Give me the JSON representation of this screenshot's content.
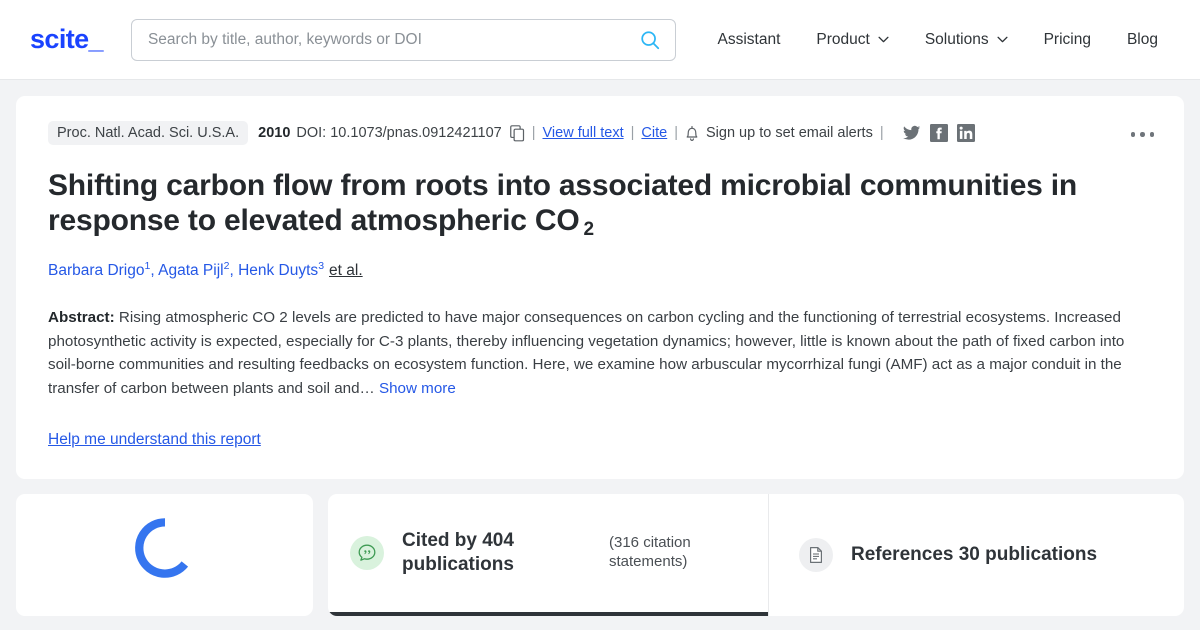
{
  "header": {
    "logo": "scite_",
    "search": {
      "placeholder": "Search by title, author, keywords or DOI",
      "value": "",
      "icon": "search-icon"
    },
    "nav": [
      {
        "label": "Assistant",
        "has_caret": false
      },
      {
        "label": "Product",
        "has_caret": true
      },
      {
        "label": "Solutions",
        "has_caret": true
      },
      {
        "label": "Pricing",
        "has_caret": false
      },
      {
        "label": "Blog",
        "has_caret": false
      }
    ]
  },
  "paper": {
    "journal": "Proc. Natl. Acad. Sci. U.S.A.",
    "year": "2010",
    "doi": "DOI: 10.1073/pnas.0912421107",
    "copy_icon": "copy-icon",
    "view_full_text": "View full text",
    "cite": "Cite",
    "alerts_icon": "bell-icon",
    "alerts": "Sign up to set email alerts",
    "separator": "|",
    "socials": [
      {
        "name": "twitter-icon"
      },
      {
        "name": "facebook-icon"
      },
      {
        "name": "linkedin-icon"
      }
    ],
    "more_menu_icon": "kebab-menu-icon",
    "title_main": "Shifting carbon flow from roots into associated microbial communities in response to elevated atmospheric CO",
    "title_sub": "2",
    "authors": [
      {
        "name": "Barbara Drigo",
        "affiliation": "1"
      },
      {
        "name": "Agata Pijl",
        "affiliation": "2"
      },
      {
        "name": "Henk Duyts",
        "affiliation": "3"
      }
    ],
    "et_al": "et al.",
    "abstract_label": "Abstract:",
    "abstract_text": "Rising atmospheric CO 2 levels are predicted to have major consequences on carbon cycling and the functioning of terrestrial ecosystems. Increased photosynthetic activity is expected, especially for C-3 plants, thereby influencing vegetation dynamics; however, little is known about the path of fixed carbon into soil-borne communities and resulting feedbacks on ecosystem function. Here, we examine how arbuscular mycorrhizal fungi (AMF) act as a major conduit in the transfer of carbon between plants and soil and…",
    "show_more": "Show more",
    "help_link": "Help me understand this report"
  },
  "bottom": {
    "spinner": {
      "name": "loading-spinner",
      "color": "#3575ef"
    },
    "tabs": [
      {
        "id": "cited-by",
        "icon": "quote-bubble-icon",
        "title": "Cited by 404 publications",
        "sub": "(316 citation statements)",
        "active": true
      },
      {
        "id": "references",
        "icon": "document-icon",
        "title": "References 30 publications",
        "sub": "",
        "active": false
      }
    ]
  },
  "colors": {
    "brand_blue": "#1a43ff",
    "link_blue": "#2558e6",
    "search_icon_cyan": "#2bb6f5",
    "page_bg": "#f2f3f5",
    "green_badge": "#d9f2dd",
    "green_icon": "#3f9b54",
    "active_tab_border": "#2f3439"
  }
}
